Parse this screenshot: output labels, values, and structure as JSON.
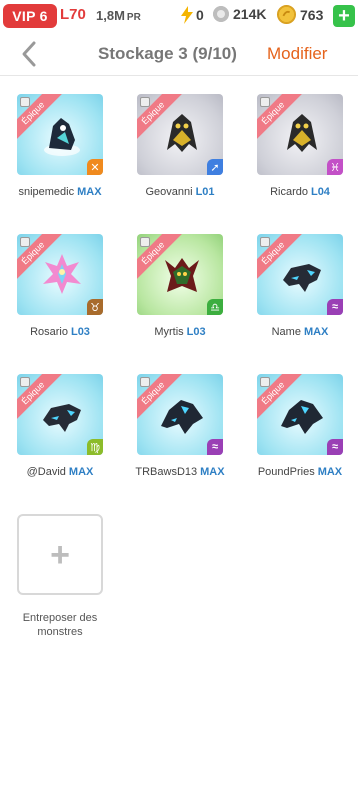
{
  "status": {
    "vip": "VIP 6",
    "level": "L70",
    "power": "1,8M",
    "power_unit": "PR",
    "energy": "0",
    "food": "214K",
    "gold": "763"
  },
  "header": {
    "title": "Stockage 3 (9/10)",
    "modify": "Modifier"
  },
  "monsters": [
    {
      "name": "snipemedic",
      "level": "MAX",
      "rarity": "Épique",
      "element": "fire"
    },
    {
      "name": "Geovanni",
      "level": "L01",
      "rarity": "Épique",
      "element": "wind"
    },
    {
      "name": "Ricardo",
      "level": "L04",
      "rarity": "Épique",
      "element": "magic"
    },
    {
      "name": "Rosario",
      "level": "L03",
      "rarity": "Épique",
      "element": "earth"
    },
    {
      "name": "Myrtis",
      "level": "L03",
      "rarity": "Épique",
      "element": "nature"
    },
    {
      "name": "Name",
      "level": "MAX",
      "rarity": "Épique",
      "element": "water"
    },
    {
      "name": "@David",
      "level": "MAX",
      "rarity": "Épique",
      "element": "virgo"
    },
    {
      "name": "TRBawsD13",
      "level": "MAX",
      "rarity": "Épique",
      "element": "water"
    },
    {
      "name": "PoundPries",
      "level": "MAX",
      "rarity": "Épique",
      "element": "water"
    }
  ],
  "add": {
    "label": "Entreposer des monstres"
  }
}
